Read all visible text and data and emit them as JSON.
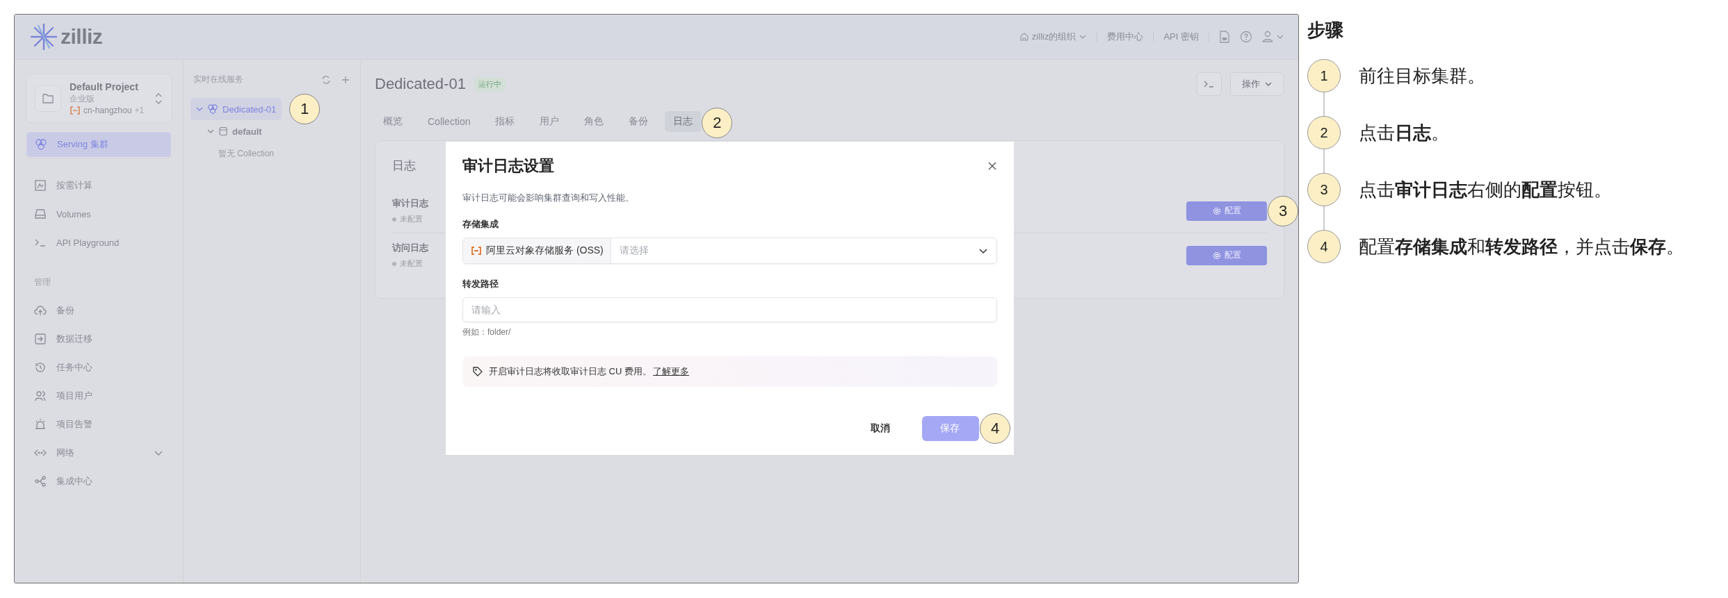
{
  "logo": {
    "text": "zilliz"
  },
  "header": {
    "org": "zilliz的组织",
    "links": [
      "费用中心",
      "API 密钥"
    ]
  },
  "project": {
    "name": "Default Project",
    "edition": "企业版",
    "region": "cn-hangzhou",
    "region_extra": "+1"
  },
  "nav": [
    {
      "label": "Serving 集群",
      "selected": true
    },
    {
      "label": "按需计算",
      "selected": false
    },
    {
      "label": "Volumes",
      "selected": false
    },
    {
      "label": "API Playground",
      "selected": false
    }
  ],
  "manage": {
    "title": "管理",
    "items": [
      {
        "label": "备份",
        "selected": false,
        "kind": "link"
      },
      {
        "label": "数据迁移",
        "selected": false,
        "kind": "link"
      },
      {
        "label": "任务中心",
        "selected": false,
        "kind": "link"
      },
      {
        "label": "项目用户",
        "selected": false,
        "kind": "link"
      },
      {
        "label": "项目告警",
        "selected": false,
        "kind": "link"
      },
      {
        "label": "网络",
        "selected": false,
        "kind": "group",
        "expanded": false
      },
      {
        "label": "集成中心",
        "selected": false,
        "kind": "link"
      }
    ]
  },
  "tree": {
    "title": "实时在线服务",
    "items": [
      {
        "label": "Dedicated-01",
        "selected": true,
        "expanded": true,
        "children": [
          {
            "label": "default",
            "selected": false,
            "expanded": true,
            "children": [
              {
                "label": "暂无 Collection",
                "kind": "empty"
              }
            ]
          }
        ]
      }
    ]
  },
  "cluster": {
    "name": "Dedicated-01",
    "status": "运行中",
    "action": "操作"
  },
  "tabs": [
    {
      "label": "概览",
      "selected": false
    },
    {
      "label": "Collection",
      "selected": false
    },
    {
      "label": "指标",
      "selected": false
    },
    {
      "label": "用户",
      "selected": false
    },
    {
      "label": "角色",
      "selected": false
    },
    {
      "label": "备份",
      "selected": false
    },
    {
      "label": "日志",
      "selected": true
    }
  ],
  "logs": {
    "title": "日志",
    "items": [
      {
        "name": "审计日志",
        "status": "未配置",
        "button": "配置"
      },
      {
        "name": "访问日志",
        "status": "未配置",
        "button": "配置"
      }
    ]
  },
  "dialog": {
    "title": "审计日志设置",
    "description": "审计日志可能会影响集群查询和写入性能。",
    "storage_label": "存储集成",
    "storage_prefix": "阿里云对象存储服务 (OSS)",
    "storage_placeholder": "请选择",
    "path_label": "转发路径",
    "path_placeholder": "请输入",
    "path_hint": "例如：folder/",
    "notice": "开启审计日志将收取审计日志 CU 费用。",
    "notice_link": "了解更多",
    "cancel": "取消",
    "save": "保存"
  },
  "callouts": [
    "1",
    "2",
    "3",
    "4"
  ],
  "steps": {
    "title": "步骤",
    "items": [
      {
        "number": "1",
        "text": "前往目标集群。"
      },
      {
        "number": "2",
        "text": "点击**日志**。"
      },
      {
        "number": "3",
        "text": "点击**审计日志**右侧的**配置**按钮。"
      },
      {
        "number": "4",
        "text": "配置**存储集成**和**转发路径**，并点击**保存**。"
      }
    ]
  }
}
